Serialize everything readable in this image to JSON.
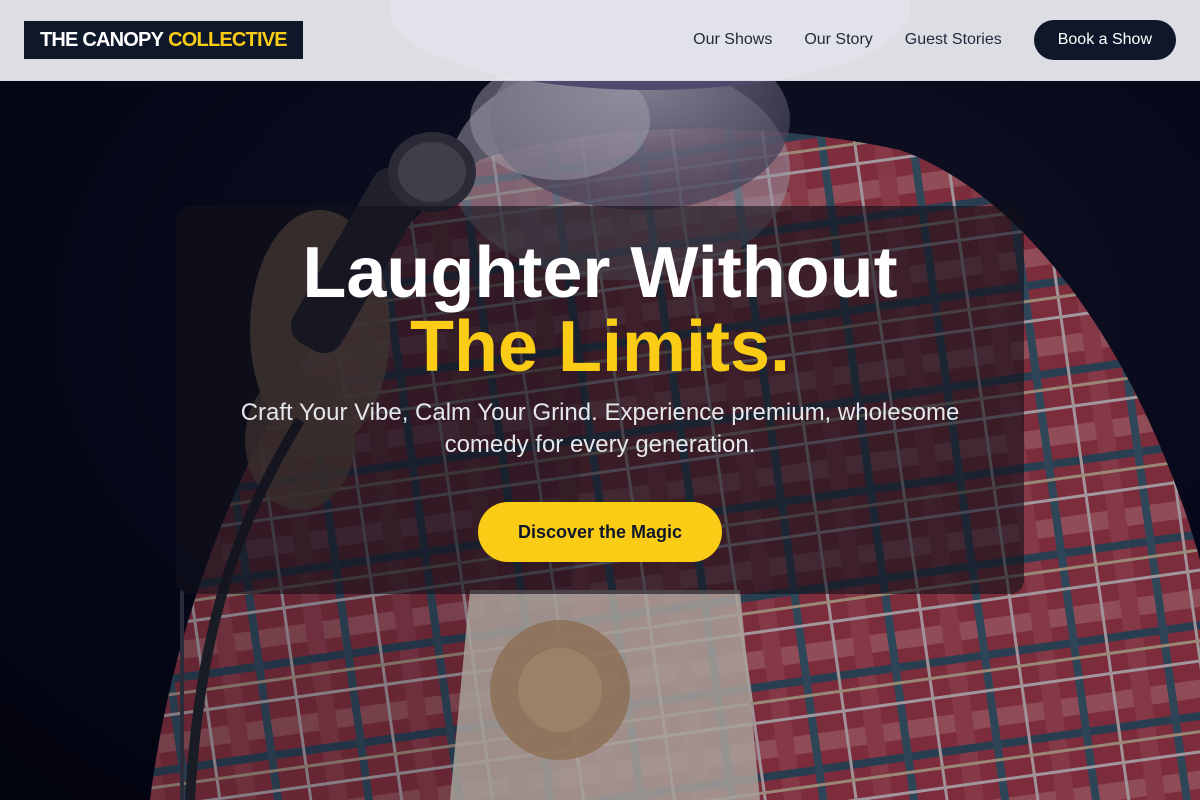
{
  "header": {
    "logo": {
      "primary": "THE CANOPY",
      "accent": "COLLECTIVE"
    },
    "nav": [
      {
        "label": "Our Shows"
      },
      {
        "label": "Our Story"
      },
      {
        "label": "Guest Stories"
      }
    ],
    "cta_label": "Book a Show"
  },
  "hero": {
    "headline_line1": "Laughter Without",
    "headline_line2": "The Limits.",
    "subtitle": "Craft Your Vibe, Calm Your Grind. Experience premium, wholesome comedy for every generation.",
    "cta_label": "Discover the Magic",
    "background_image": "comedian-with-microphone-photo"
  },
  "colors": {
    "accent": "#facc15",
    "navy": "#0f172a",
    "header_bg": "#eeeff3"
  }
}
